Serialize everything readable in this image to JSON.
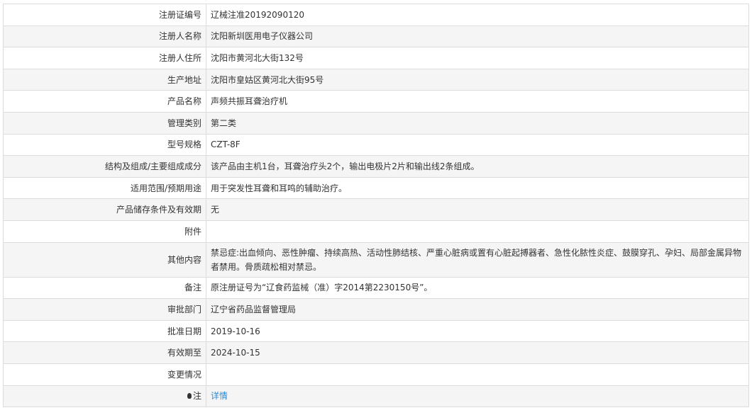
{
  "rows": [
    {
      "label": "注册证编号",
      "value": "辽械注准20192090120"
    },
    {
      "label": "注册人名称",
      "value": "沈阳新圳医用电子仪器公司"
    },
    {
      "label": "注册人住所",
      "value": "沈阳市黄河北大街132号"
    },
    {
      "label": "生产地址",
      "value": "沈阳市皇姑区黄河北大街95号"
    },
    {
      "label": "产品名称",
      "value": "声频共振耳聋治疗机"
    },
    {
      "label": "管理类别",
      "value": "第二类"
    },
    {
      "label": "型号规格",
      "value": "CZT-8F"
    },
    {
      "label": "结构及组成/主要组成成分",
      "value": "该产品由主机1台，耳聋治疗头2个，输出电极片2片和输出线2条组成。"
    },
    {
      "label": "适用范围/预期用途",
      "value": "用于突发性耳聋和耳鸣的辅助治疗。"
    },
    {
      "label": "产品储存条件及有效期",
      "value": "无"
    },
    {
      "label": "附件",
      "value": ""
    },
    {
      "label": "其他内容",
      "value": "禁忌症:出血倾向、恶性肿瘤、持续高热、活动性肺结核、严重心脏病或置有心脏起搏器者、急性化脓性炎症、鼓膜穿孔、孕妇、局部金属异物者禁用。骨质疏松相对禁忌。"
    },
    {
      "label": "备注",
      "value": "原注册证号为“辽食药监械（准）字2014第2230150号”。"
    },
    {
      "label": "审批部门",
      "value": "辽宁省药品监督管理局"
    },
    {
      "label": "批准日期",
      "value": "2019-10-16"
    },
    {
      "label": "有效期至",
      "value": "2024-10-15"
    },
    {
      "label": "变更情况",
      "value": ""
    },
    {
      "label": "注",
      "value": "详情",
      "icon": "lightbulb-icon"
    }
  ],
  "link_color": "#2a8ad4"
}
